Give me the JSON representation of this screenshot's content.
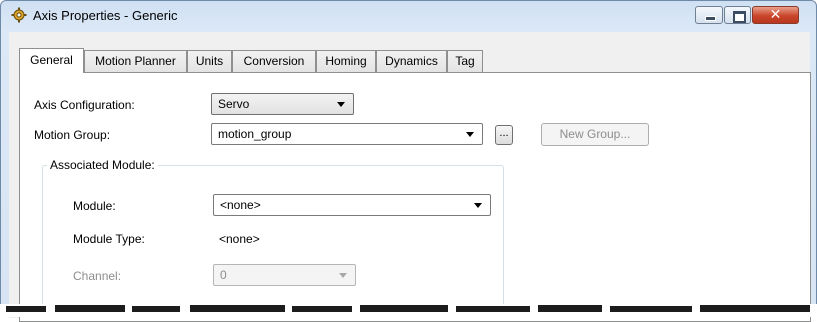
{
  "window": {
    "title": "Axis Properties - Generic",
    "icon": "axis-gear-icon",
    "controls": {
      "minimize": "minimize-icon",
      "maximize": "maximize-icon",
      "close": "close-icon",
      "close_glyph": "✕"
    }
  },
  "tabs": [
    {
      "label": "General",
      "active": true
    },
    {
      "label": "Motion Planner",
      "active": false
    },
    {
      "label": "Units",
      "active": false
    },
    {
      "label": "Conversion",
      "active": false
    },
    {
      "label": "Homing",
      "active": false
    },
    {
      "label": "Dynamics",
      "active": false
    },
    {
      "label": "Tag",
      "active": false
    }
  ],
  "general": {
    "axis_configuration": {
      "label": "Axis Configuration:",
      "value": "Servo"
    },
    "motion_group": {
      "label": "Motion Group:",
      "value": "motion_group",
      "browse_label": "...",
      "new_group_label": "New Group..."
    },
    "associated_module": {
      "legend": "Associated Module:",
      "module": {
        "label": "Module:",
        "value": "<none>"
      },
      "module_type": {
        "label": "Module Type:",
        "value": "<none>"
      },
      "channel": {
        "label": "Channel:",
        "value": "0"
      }
    }
  },
  "colors": {
    "accent": "#6f8aa8",
    "close": "#c9462b"
  }
}
